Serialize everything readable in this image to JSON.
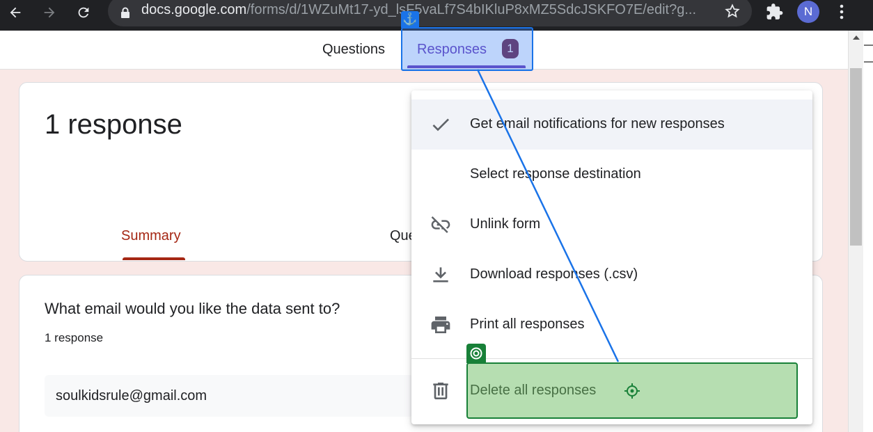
{
  "browser": {
    "url_host": "docs.google.com",
    "url_path": "/forms/d/1WZuMt17-yd_lsF5vaLf7S4bIKluP8xMZ5SdcJSKFO7E/edit?g...",
    "avatar_letter": "N"
  },
  "tabs": {
    "questions": "Questions",
    "responses": "Responses",
    "responses_badge": "1"
  },
  "summary_card": {
    "response_count": "1 response",
    "subtab_summary": "Summary",
    "subtab_question": "Que"
  },
  "question_card": {
    "title": "What email would you like the data sent to?",
    "count": "1 response",
    "answer": "soulkidsrule@gmail.com"
  },
  "menu": {
    "items": [
      {
        "label": "Get email notifications for new responses",
        "icon": "check-icon"
      },
      {
        "label": "Select response destination",
        "icon": ""
      },
      {
        "label": "Unlink form",
        "icon": "link-off-icon"
      },
      {
        "label": "Download responses (.csv)",
        "icon": "download-icon"
      },
      {
        "label": "Print all responses",
        "icon": "print-icon"
      },
      {
        "label": "Delete all responses",
        "icon": "trash-icon"
      }
    ]
  },
  "colors": {
    "accent": "#673ab7",
    "summary_red": "#a52714",
    "badge": "#6d2342",
    "page_bg": "#f9e8e6"
  }
}
